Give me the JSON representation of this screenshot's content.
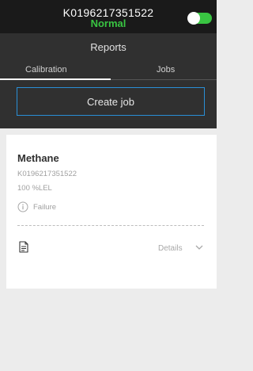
{
  "device": {
    "id": "K0196217351522",
    "status": "Normal",
    "toggle_on": true
  },
  "header": {
    "title": "Reports",
    "tabs": [
      {
        "label": "Calibration",
        "active": true
      },
      {
        "label": "Jobs",
        "active": false
      }
    ],
    "create_job_label": "Create job"
  },
  "report": {
    "gas": "Methane",
    "serial": "K0196217351522",
    "reading": "100 %LEL",
    "result": "Failure",
    "details_label": "Details",
    "icons": [
      "info-icon",
      "document-icon",
      "chevron-down-icon"
    ]
  },
  "colors": {
    "status_green": "#39c542",
    "accent_blue": "#2a8fd6",
    "header_bg": "#303030",
    "status_bar_bg": "#1a1a1a"
  }
}
